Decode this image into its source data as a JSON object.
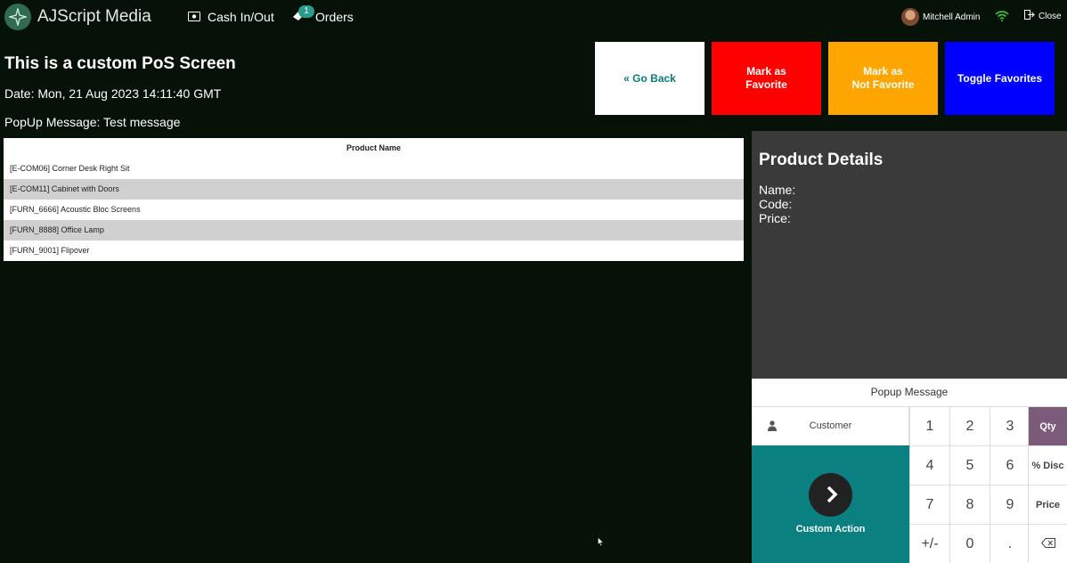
{
  "header": {
    "brand": "AJScript Media",
    "cash_label": "Cash In/Out",
    "orders_label": "Orders",
    "orders_badge": "1",
    "user_name": "Mitchell Admin",
    "close_label": "Close"
  },
  "screen": {
    "title": "This is a custom PoS Screen",
    "date_line": "Date: Mon, 21 Aug 2023 14:11:40 GMT",
    "popup_line": "PopUp Message: Test message"
  },
  "actions": {
    "go_back": "« Go Back",
    "mark_favorite": "Mark as\nFavorite",
    "mark_not_favorite": "Mark as\nNot Favorite",
    "toggle_favorites": "Toggle Favorites"
  },
  "table": {
    "header": "Product Name",
    "rows": [
      "[E-COM06] Corner Desk Right Sit",
      "[E-COM11] Cabinet with Doors",
      "[FURN_6666] Acoustic Bloc Screens",
      "[FURN_8888] Office Lamp",
      "[FURN_9001] Flipover"
    ]
  },
  "details": {
    "title": "Product Details",
    "name_label": "Name:",
    "code_label": "Code:",
    "price_label": "Price:"
  },
  "numpad": {
    "popup_message": "Popup Message",
    "customer": "Customer",
    "custom_action": "Custom Action",
    "keys": [
      "1",
      "2",
      "3",
      "4",
      "5",
      "6",
      "7",
      "8",
      "9",
      "+/-",
      "0",
      "."
    ],
    "modes": [
      "Qty",
      "% Disc",
      "Price"
    ],
    "active_mode": "Qty"
  },
  "colors": {
    "background": "#061108",
    "go_back_text": "#0a7c7a",
    "favorite": "#ff0000",
    "not_favorite": "#ffa500",
    "toggle": "#0000ff",
    "custom_action": "#0a8080",
    "active_mode": "#7b5a7a"
  }
}
